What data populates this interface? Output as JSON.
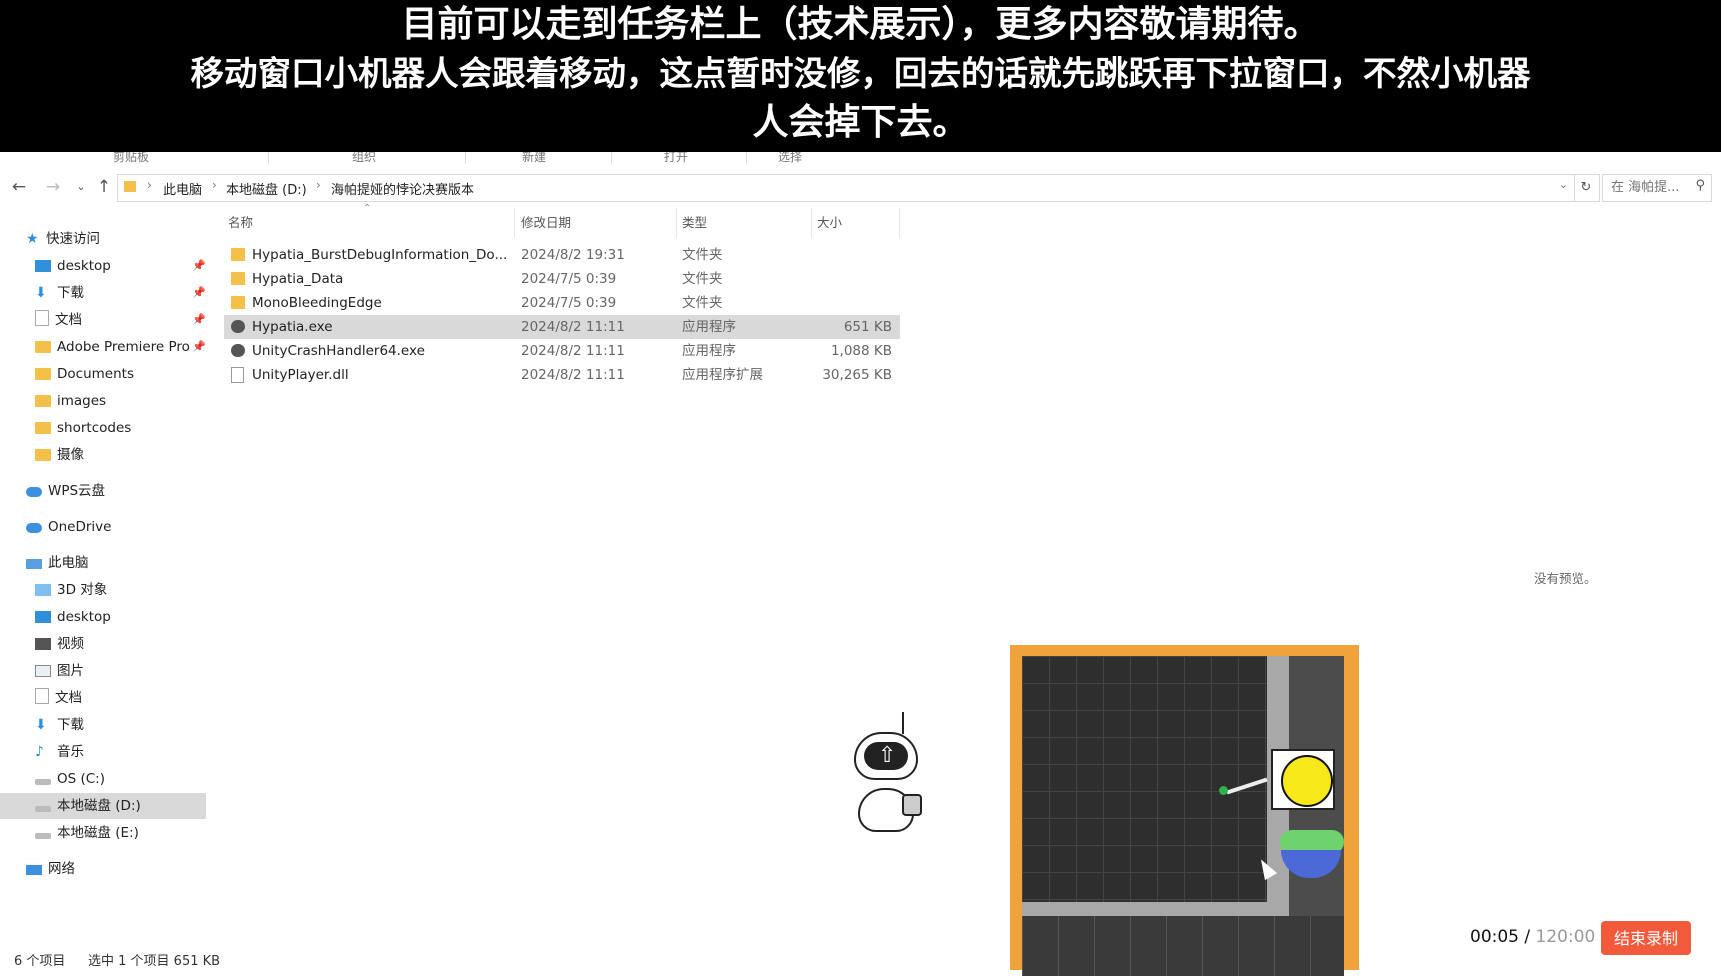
{
  "banner": {
    "lines": [
      "目前可以走到任务栏上（技术展示），更多内容敬请期待。",
      "移动窗口小机器人会跟着移动，这点暂时没修，回去的话就先跳跃再下拉窗口，不然小机器",
      "人会掉下去。"
    ]
  },
  "ribbon": {
    "groups": [
      "剪贴板",
      "组织",
      "新建",
      "打开",
      "选择"
    ]
  },
  "address_bar": {
    "breadcrumbs": [
      "此电脑",
      "本地磁盘 (D:)",
      "海帕提娅的悖论决赛版本"
    ],
    "search_placeholder": "在 海帕提..."
  },
  "sidebar": {
    "items": [
      {
        "label": "快速访问",
        "icon": "star-icon",
        "pinned": false
      },
      {
        "label": "desktop",
        "icon": "desktop-folder-icon",
        "pinned": true
      },
      {
        "label": "下载",
        "icon": "download-icon",
        "pinned": true
      },
      {
        "label": "文档",
        "icon": "document-icon",
        "pinned": true
      },
      {
        "label": "Adobe Premiere Pro",
        "icon": "folder-icon",
        "pinned": true
      },
      {
        "label": "Documents",
        "icon": "folder-icon",
        "pinned": false
      },
      {
        "label": "images",
        "icon": "folder-icon",
        "pinned": false
      },
      {
        "label": "shortcodes",
        "icon": "folder-icon",
        "pinned": false
      },
      {
        "label": "摄像",
        "icon": "folder-icon",
        "pinned": false
      },
      {
        "label": "WPS云盘",
        "icon": "cloud-icon",
        "pinned": false
      },
      {
        "label": "OneDrive",
        "icon": "onedrive-icon",
        "pinned": false
      },
      {
        "label": "此电脑",
        "icon": "pc-icon",
        "pinned": false
      },
      {
        "label": "3D 对象",
        "icon": "3d-objects-icon",
        "pinned": false
      },
      {
        "label": "desktop",
        "icon": "desktop-folder-icon",
        "pinned": false
      },
      {
        "label": "视频",
        "icon": "video-icon",
        "pinned": false
      },
      {
        "label": "图片",
        "icon": "picture-icon",
        "pinned": false
      },
      {
        "label": "文档",
        "icon": "document-icon",
        "pinned": false
      },
      {
        "label": "下载",
        "icon": "download-icon",
        "pinned": false
      },
      {
        "label": "音乐",
        "icon": "music-icon",
        "pinned": false
      },
      {
        "label": "OS (C:)",
        "icon": "drive-icon",
        "pinned": false
      },
      {
        "label": "本地磁盘 (D:)",
        "icon": "drive-icon",
        "pinned": false,
        "selected": true
      },
      {
        "label": "本地磁盘 (E:)",
        "icon": "drive-icon",
        "pinned": false
      },
      {
        "label": "网络",
        "icon": "network-icon",
        "pinned": false
      }
    ]
  },
  "filelist": {
    "columns": [
      "名称",
      "修改日期",
      "类型",
      "大小"
    ],
    "rows": [
      {
        "name": "Hypatia_BurstDebugInformation_Do...",
        "date": "2024/8/2 19:31",
        "type": "文件夹",
        "size": "",
        "icon": "folder-icon"
      },
      {
        "name": "Hypatia_Data",
        "date": "2024/7/5 0:39",
        "type": "文件夹",
        "size": "",
        "icon": "folder-icon"
      },
      {
        "name": "MonoBleedingEdge",
        "date": "2024/7/5 0:39",
        "type": "文件夹",
        "size": "",
        "icon": "folder-icon"
      },
      {
        "name": "Hypatia.exe",
        "date": "2024/8/2 11:11",
        "type": "应用程序",
        "size": "651 KB",
        "icon": "unity-exe-icon",
        "selected": true
      },
      {
        "name": "UnityCrashHandler64.exe",
        "date": "2024/8/2 11:11",
        "type": "应用程序",
        "size": "1,088 KB",
        "icon": "unity-exe-icon"
      },
      {
        "name": "UnityPlayer.dll",
        "date": "2024/8/2 11:11",
        "type": "应用程序扩展",
        "size": "30,265 KB",
        "icon": "dll-icon"
      }
    ]
  },
  "preview_pane": {
    "text": "没有预览。"
  },
  "statusbar": {
    "item_count": "6 个项目",
    "selection": "选中 1 个项目  651 KB"
  },
  "recording": {
    "elapsed": "00:05",
    "separator": " / ",
    "total": "120:00",
    "stop_label": "结束录制"
  },
  "colors": {
    "banner_bg": "#000000",
    "selection": "#d9d9d9",
    "game_frame": "#f0a33a",
    "stop_button": "#f25a3b"
  }
}
